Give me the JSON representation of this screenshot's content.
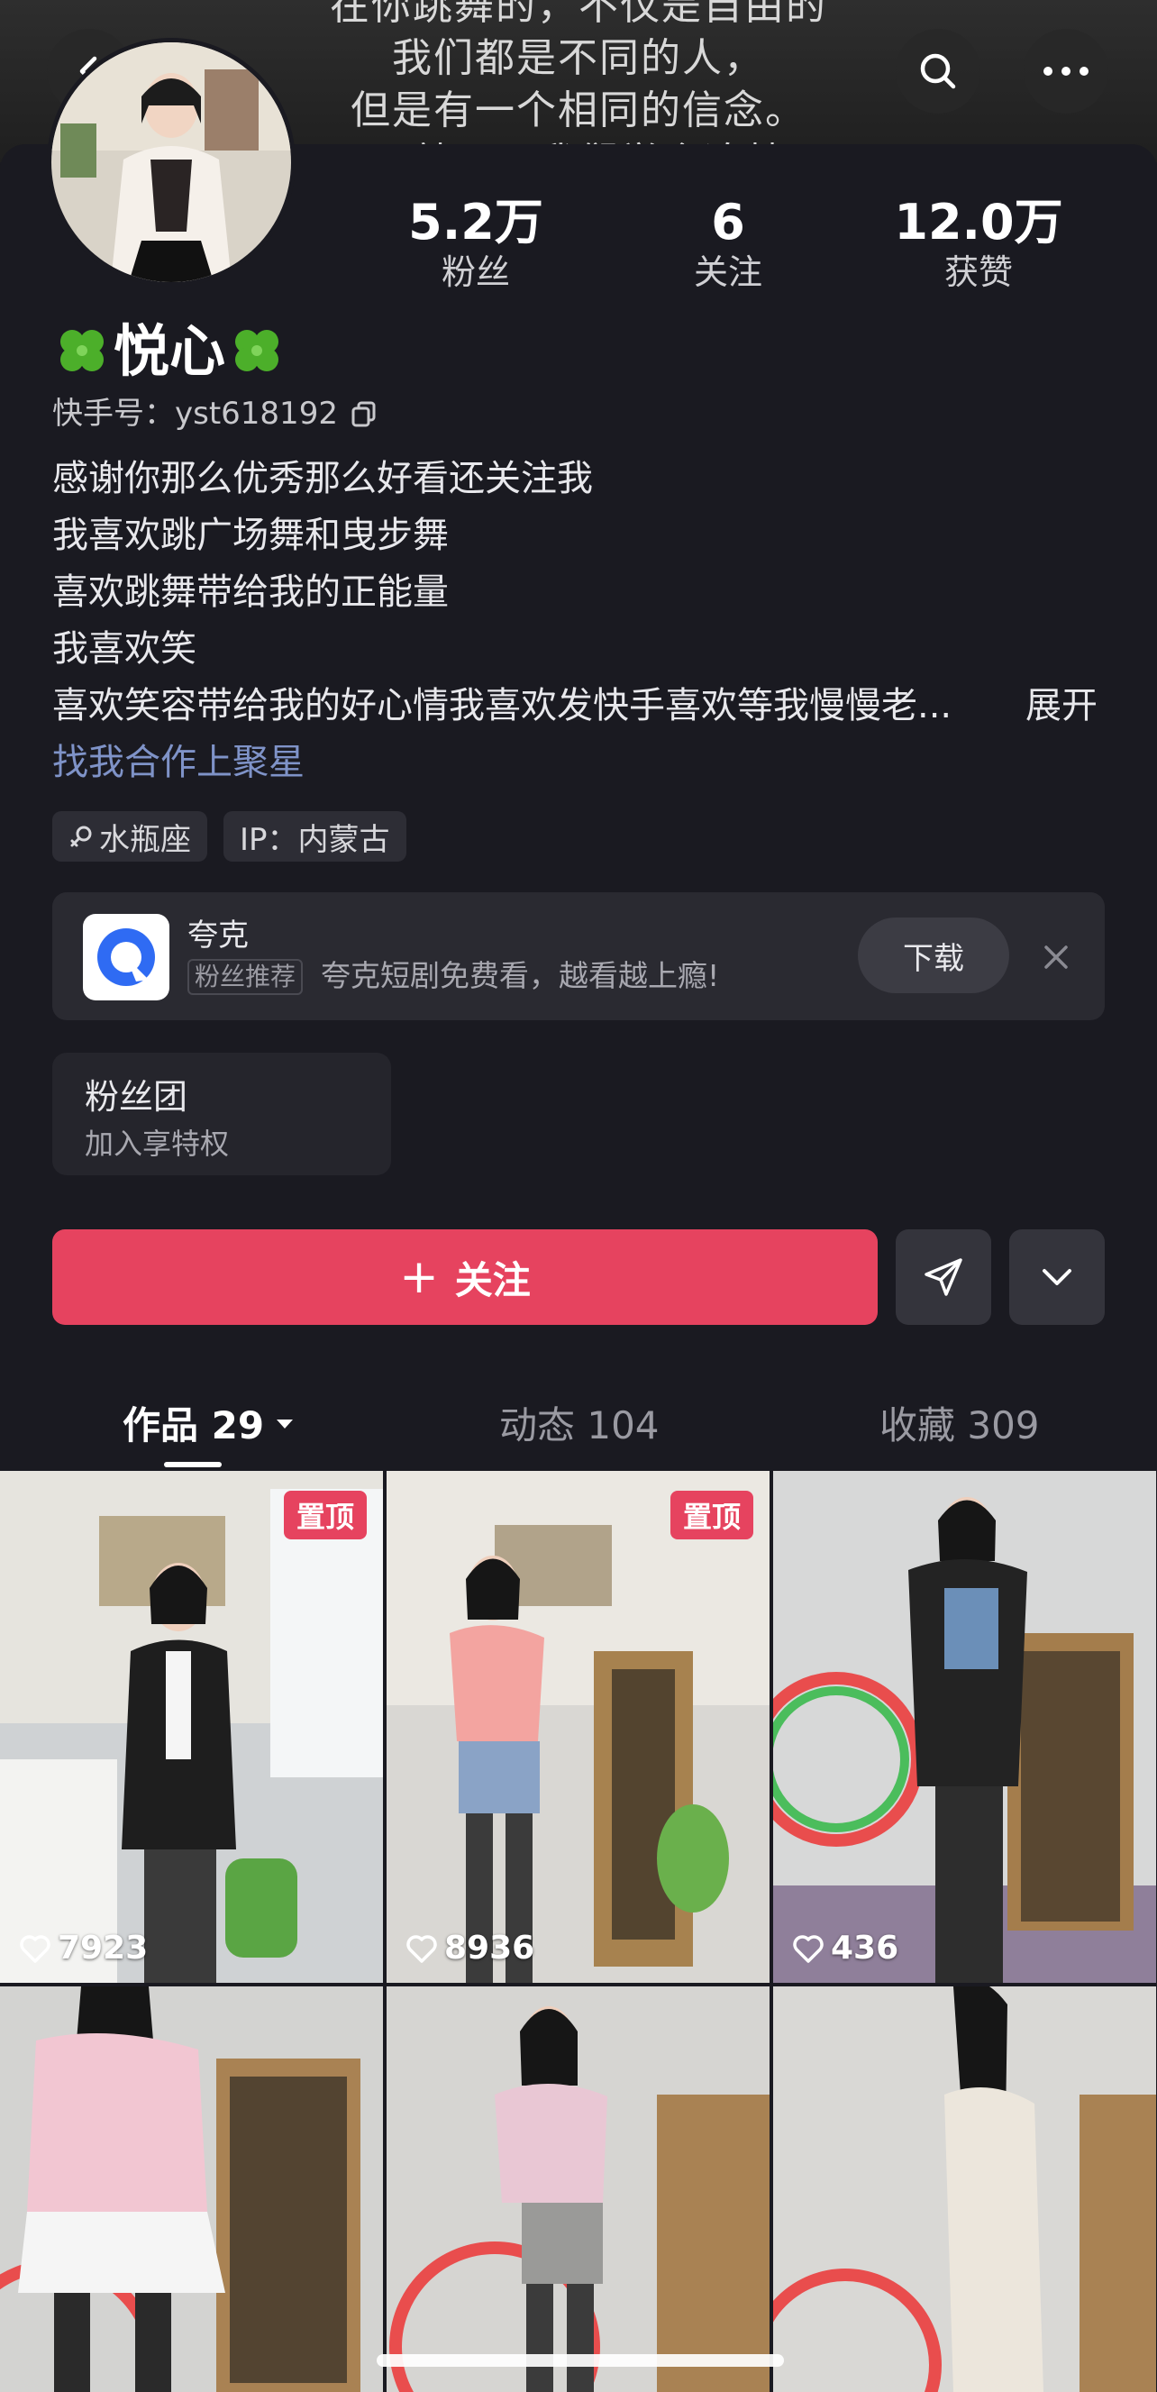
{
  "banner": {
    "lines": [
      "在你跳舞的，不仅是自由的",
      "我们都是不同的人，",
      "但是有一个相同的信念。",
      "那就是：我们学会追梦"
    ]
  },
  "header": {
    "back_icon": "chevron-left-icon",
    "search_icon": "search-icon",
    "more_icon": "more-horizontal-icon"
  },
  "profile": {
    "name": "悦心",
    "name_emoji": "clover-icon",
    "kuaishou_label": "快手号：",
    "kuaishou_id": "yst618192",
    "stats": [
      {
        "num": "5.2万",
        "label": "粉丝"
      },
      {
        "num": "6",
        "label": "关注"
      },
      {
        "num": "12.0万",
        "label": "获赞"
      }
    ],
    "bio": [
      "感谢你那么优秀那么好看还关注我",
      "我喜欢跳广场舞和曳步舞",
      "喜欢跳舞带给我的正能量",
      "我喜欢笑",
      "喜欢笑容带给我的好心情我喜欢发快手喜欢等我慢慢老..."
    ],
    "bio_more": "展开",
    "bio_link": "找我合作上聚星",
    "tags": [
      "水瓶座",
      "IP：内蒙古"
    ]
  },
  "ad": {
    "title": "夸克",
    "badge": "粉丝推荐",
    "desc": "夸克短剧免费看，越看越上瘾!",
    "download": "下载"
  },
  "fans_group": {
    "title": "粉丝团",
    "subtitle": "加入享特权"
  },
  "actions": {
    "follow": "关注",
    "follow_plus": "+"
  },
  "tabs": [
    {
      "label": "作品 29"
    },
    {
      "label": "动态 104"
    },
    {
      "label": "收藏 309"
    }
  ],
  "videos": [
    {
      "likes": "7923",
      "pinned": "置顶",
      "accent": "#1e1e1e"
    },
    {
      "likes": "8936",
      "pinned": "置顶",
      "accent": "#f3a4a0"
    },
    {
      "likes": "436",
      "pinned": "",
      "accent": "#6b8fb8"
    },
    {
      "likes": "",
      "pinned": "",
      "accent": "#f2c6d2"
    },
    {
      "likes": "",
      "pinned": "",
      "accent": "#e9c7d4"
    },
    {
      "likes": "",
      "pinned": "",
      "accent": "#ece6dc"
    }
  ],
  "colors": {
    "background": "#1a1a21",
    "follow_button": "#e6435f",
    "pin_badge": "#e6435f",
    "link": "#7f93c8"
  }
}
